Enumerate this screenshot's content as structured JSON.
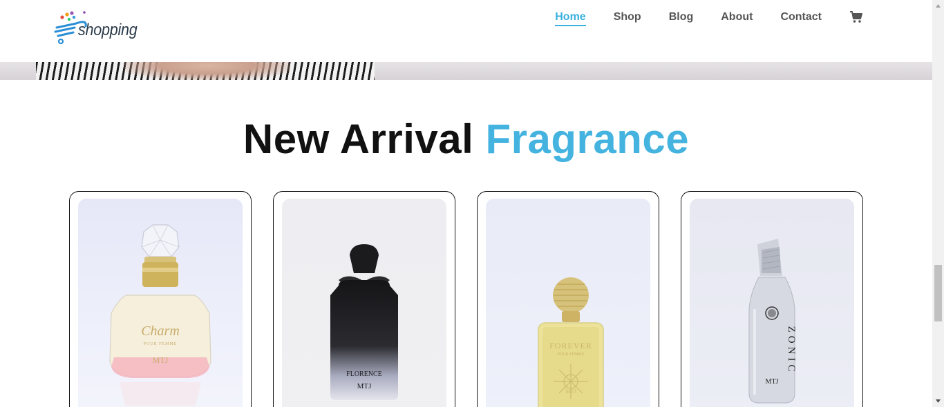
{
  "brand": {
    "logo_text": "shopping"
  },
  "nav": {
    "items": [
      {
        "label": "Home",
        "active": true
      },
      {
        "label": "Shop",
        "active": false
      },
      {
        "label": "Blog",
        "active": false
      },
      {
        "label": "About",
        "active": false
      },
      {
        "label": "Contact",
        "active": false
      }
    ],
    "cart_icon": "cart-icon"
  },
  "section": {
    "title_main": "New Arrival",
    "title_accent": "Fragrance"
  },
  "products": [
    {
      "bottle_label": "Charm",
      "bottle_sub": "POUR FEMME",
      "brand_mark": "MTJ"
    },
    {
      "bottle_label": "FLORENCE",
      "bottle_sub": "",
      "brand_mark": "MTJ"
    },
    {
      "bottle_label": "FOREVER",
      "bottle_sub": "POUR FEMME",
      "brand_mark": "MTJ"
    },
    {
      "bottle_label": "ZONIC",
      "bottle_sub": "",
      "brand_mark": "MTJ"
    }
  ],
  "colors": {
    "accent": "#45b3df",
    "nav_active": "#3ab0de",
    "nav_text": "#555555",
    "title": "#111111"
  }
}
